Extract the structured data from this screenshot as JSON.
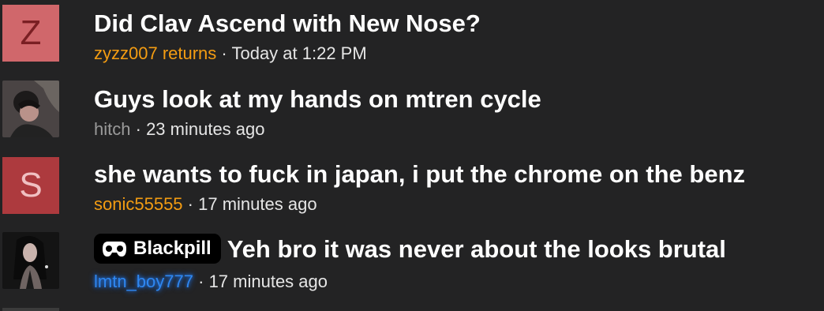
{
  "colors": {
    "background": "#232324",
    "orange_user": "#f39c12",
    "gray_user": "#9a9a9a",
    "blue_user": "#2f87f0"
  },
  "threads": [
    {
      "avatar_letter": "Z",
      "title": "Did Clav Ascend with New Nose?",
      "author": "zyzz007 returns",
      "separator": "·",
      "time": "Today at 1:22 PM"
    },
    {
      "avatar_icon": "user-photo-avatar",
      "title": "Guys look at my hands on mtren cycle",
      "author": "hitch",
      "separator": "·",
      "time": "23 minutes ago"
    },
    {
      "avatar_letter": "S",
      "title": "she wants to fuck in japan, i put the chrome on the benz",
      "author": "sonic55555",
      "separator": "·",
      "time": "17 minutes ago"
    },
    {
      "avatar_icon": "user-photo-avatar",
      "prefix_icon": "gamepad-icon",
      "prefix": "Blackpill",
      "title": "Yeh bro it was never about the looks brutal",
      "author": "lmtn_boy777",
      "separator": "·",
      "time": "17 minutes ago"
    }
  ]
}
